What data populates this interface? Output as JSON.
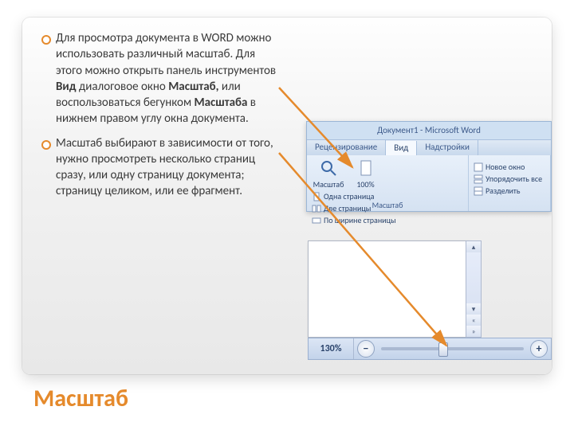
{
  "title": "Масштаб",
  "bullets": [
    "Для просмотра документа в WORD можно использовать различный масштаб. Для этого можно открыть панель инструментов <b>Вид</b> диалоговое окно <b>Масштаб,</b> или воспользоваться бегунком <b>Масштаба</b> в нижнем правом углу окна документа.",
    "Масштаб выбирают в зависимости от того, нужно просмотреть несколько страниц сразу, или одну страницу документа; страницу целиком, или ее фрагмент."
  ],
  "ribbon": {
    "window_title": "Документ1 - Microsoft Word",
    "tabs": [
      "Рецензирование",
      "Вид",
      "Надстройки"
    ],
    "active_tab": "Вид",
    "zoom_group_label": "Масштаб",
    "zoom_button": "Масштаб",
    "zoom_100": "100%",
    "page_options": [
      "Одна страница",
      "Две страницы",
      "По ширине страницы"
    ],
    "window_options": [
      "Новое окно",
      "Упорядочить все",
      "Разделить"
    ]
  },
  "statusbar": {
    "zoom_value": "130%",
    "minus": "−",
    "plus": "+"
  }
}
